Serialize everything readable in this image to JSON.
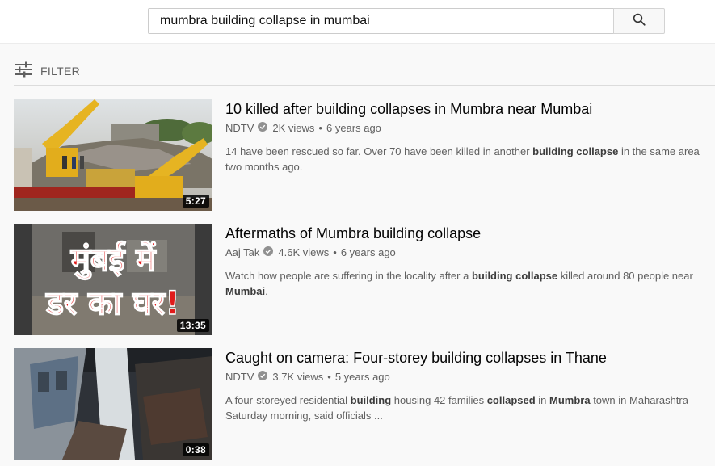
{
  "search": {
    "query": "mumbra building collapse in mumbai"
  },
  "filter": {
    "label": "FILTER"
  },
  "results": [
    {
      "title": "10 killed after building collapses in Mumbra near Mumbai",
      "channel": "NDTV",
      "views": "2K views",
      "age": "6 years ago",
      "duration": "5:27",
      "desc": [
        {
          "t": "14 have been rescued so far. Over 70 have been killed in another ",
          "b": false
        },
        {
          "t": "building collapse",
          "b": true
        },
        {
          "t": " in the same area two months ago.",
          "b": false
        }
      ]
    },
    {
      "title": "Aftermaths of Mumbra building collapse",
      "channel": "Aaj Tak",
      "views": "4.6K views",
      "age": "6 years ago",
      "duration": "13:35",
      "thumb_text_line1": "मुंबई में",
      "thumb_text_line2": "डर का घर!",
      "desc": [
        {
          "t": "Watch how people are suffering in the locality after a ",
          "b": false
        },
        {
          "t": "building collapse",
          "b": true
        },
        {
          "t": " killed around 80 people near ",
          "b": false
        },
        {
          "t": "Mumbai",
          "b": true
        },
        {
          "t": ".",
          "b": false
        }
      ]
    },
    {
      "title": "Caught on camera: Four-storey building collapses in Thane",
      "channel": "NDTV",
      "views": "3.7K views",
      "age": "5 years ago",
      "duration": "0:38",
      "desc": [
        {
          "t": "A four-storeyed residential ",
          "b": false
        },
        {
          "t": "building",
          "b": true
        },
        {
          "t": " housing 42 families ",
          "b": false
        },
        {
          "t": "collapsed",
          "b": true
        },
        {
          "t": " in ",
          "b": false
        },
        {
          "t": "Mumbra",
          "b": true
        },
        {
          "t": " town in Maharashtra Saturday morning, said officials ...",
          "b": false
        }
      ]
    }
  ],
  "icons": {
    "search": "search-icon",
    "filter": "filter-sliders-icon",
    "verified": "verified-check-icon"
  },
  "colors": {
    "title": "#030303",
    "meta": "#606060",
    "background": "#f9f9f9"
  }
}
